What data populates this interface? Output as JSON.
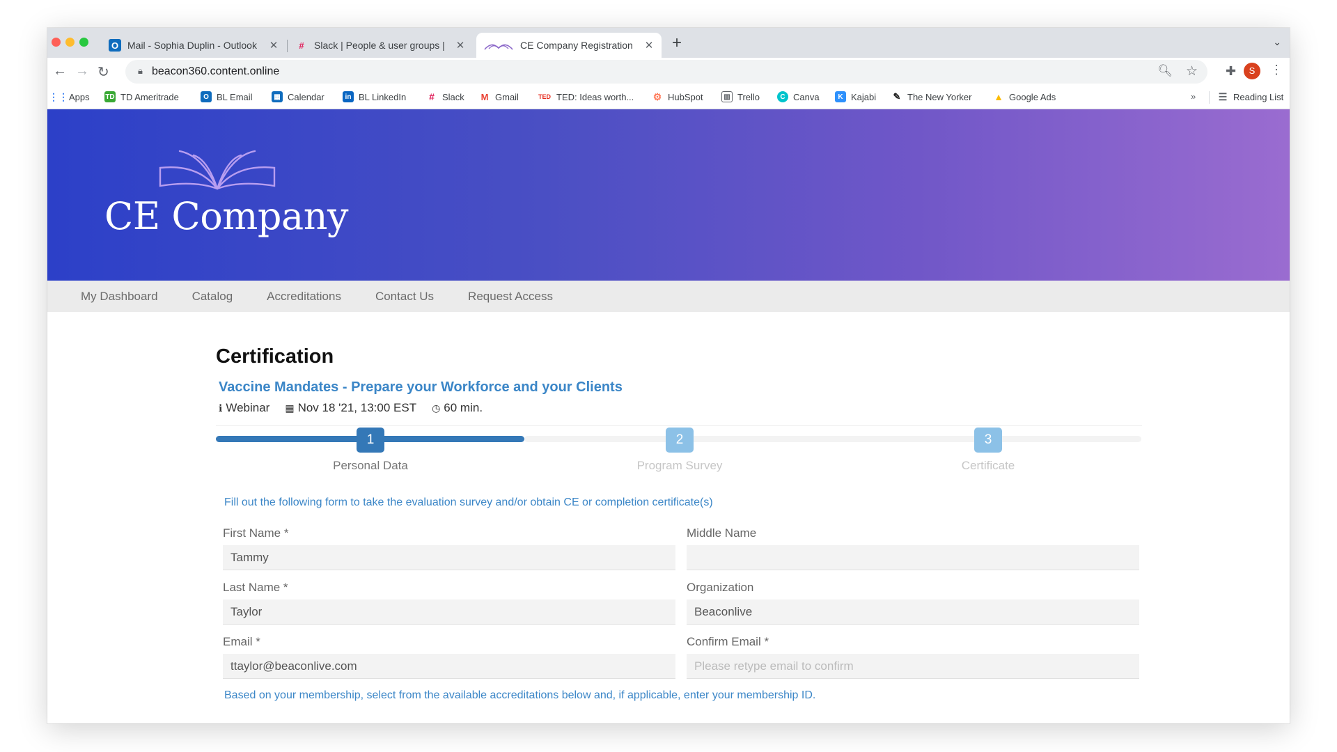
{
  "browser": {
    "tabs": [
      {
        "title": "Mail - Sophia Duplin - Outlook",
        "icon": "outlook-icon",
        "active": false
      },
      {
        "title": "Slack | People & user groups |",
        "icon": "slack-icon",
        "active": false
      },
      {
        "title": "CE Company Registration",
        "icon": "book-logo-icon",
        "active": true
      }
    ],
    "new_tab": "+",
    "url": "beacon360.content.online",
    "profile_initial": "S",
    "bookmarks": [
      {
        "label": "Apps",
        "icon": "apps-grid-icon"
      },
      {
        "label": "TD Ameritrade",
        "icon": "td-icon"
      },
      {
        "label": "BL Email",
        "icon": "outlook-icon"
      },
      {
        "label": "Calendar",
        "icon": "calendar-icon"
      },
      {
        "label": "BL LinkedIn",
        "icon": "linkedin-icon"
      },
      {
        "label": "Slack",
        "icon": "slack-icon"
      },
      {
        "label": "Gmail",
        "icon": "gmail-icon"
      },
      {
        "label": "TED: Ideas worth...",
        "icon": "ted-icon"
      },
      {
        "label": "HubSpot",
        "icon": "hubspot-icon"
      },
      {
        "label": "Trello",
        "icon": "trello-icon"
      },
      {
        "label": "Canva",
        "icon": "canva-icon"
      },
      {
        "label": "Kajabi",
        "icon": "kajabi-icon"
      },
      {
        "label": "The New Yorker",
        "icon": "new-yorker-icon"
      },
      {
        "label": "Google Ads",
        "icon": "google-ads-icon"
      }
    ],
    "more": "»",
    "reading_list": "Reading List"
  },
  "site": {
    "brand": "CE Company",
    "nav": [
      "My Dashboard",
      "Catalog",
      "Accreditations",
      "Contact Us",
      "Request Access"
    ]
  },
  "page": {
    "heading": "Certification",
    "event_title": "Vaccine Mandates - Prepare your Workforce and your Clients",
    "meta": {
      "type": "Webinar",
      "date": "Nov 18 '21, 13:00 EST",
      "duration": "60 min."
    },
    "steps": [
      {
        "number": "1",
        "label": "Personal Data",
        "state": "active"
      },
      {
        "number": "2",
        "label": "Program Survey",
        "state": "pending"
      },
      {
        "number": "3",
        "label": "Certificate",
        "state": "pending"
      }
    ],
    "instructions": "Fill out the following form to take the evaluation survey and/or obtain CE or completion certificate(s)",
    "fields": {
      "first_name": {
        "label": "First Name  *",
        "value": "Tammy"
      },
      "middle_name": {
        "label": "Middle Name",
        "value": ""
      },
      "last_name": {
        "label": "Last Name  *",
        "value": "Taylor"
      },
      "organization": {
        "label": "Organization",
        "value": "Beaconlive"
      },
      "email": {
        "label": "Email  *",
        "value": "ttaylor@beaconlive.com"
      },
      "confirm_email": {
        "label": "Confirm Email  *",
        "value": "",
        "placeholder": "Please retype email to confirm"
      }
    },
    "accreditation_note": "Based on your membership, select from the available accreditations below and, if applicable, enter your membership ID."
  },
  "colors": {
    "hero_start": "#2c40c8",
    "hero_end": "#9a6cd0",
    "accent_blue": "#3b86c7",
    "step_active": "#3478b7",
    "step_pending": "#8cc1e7"
  }
}
